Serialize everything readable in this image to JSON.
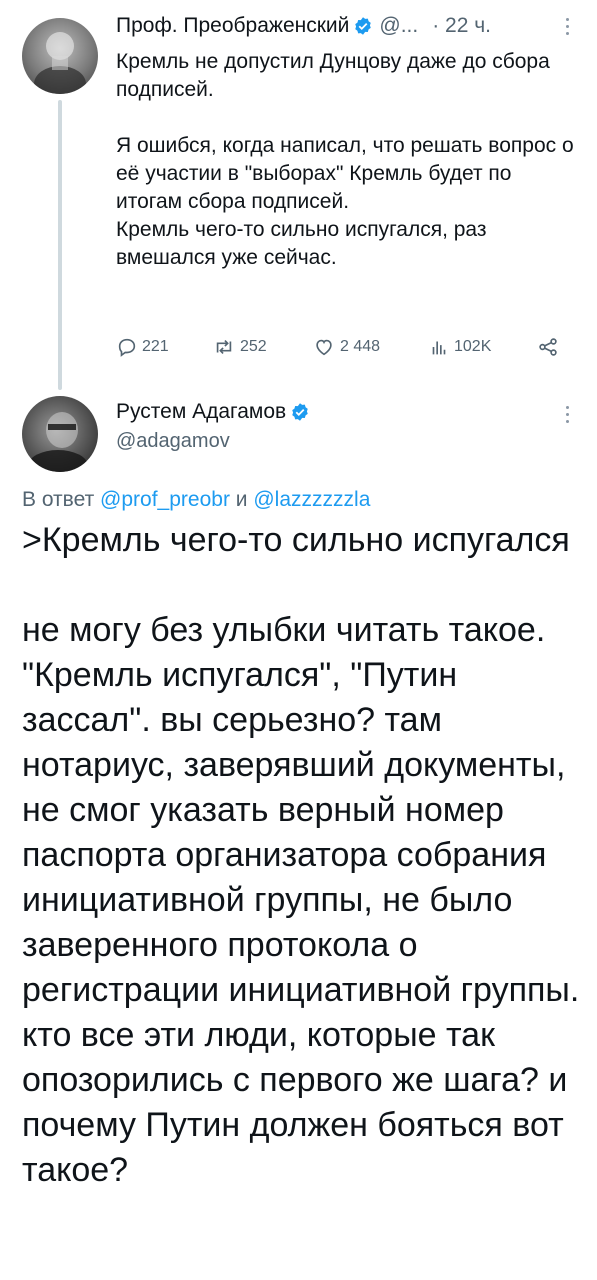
{
  "tweet1": {
    "author_name": "Проф. Преображенский",
    "handle": "@...",
    "time": "· 22 ч.",
    "body": "Кремль не допустил Дунцову даже до сбора подписей.\n\nЯ ошибся, когда написал, что решать вопрос о её участии в \"выборах\" Кремль будет по итогам сбора подписей.\nКремль чего-то сильно испугался, раз вмешался уже сейчас.",
    "actions": {
      "replies": "221",
      "retweets": "252",
      "likes": "2 448",
      "views": "102K"
    }
  },
  "tweet2": {
    "author_name": "Рустем Адагамов",
    "handle": "@adagamov",
    "reply_prefix": "В ответ",
    "reply_mention1": "@prof_preobr",
    "reply_and": "и",
    "reply_mention2": "@lazzzzzzla",
    "body": ">Кремль чего-то сильно испугался\n\nне могу без улыбки читать такое. \"Кремль испугался\", \"Путин зассал\". вы серьезно? там нотариус, заверявший документы, не смог указать верный номер паспорта организатора собрания инициативной группы, не было заверенного протокола о регистрации инициативной группы. кто все эти люди, которые так опозорились с первого же шага? и почему Путин должен бояться вот такое?"
  },
  "colors": {
    "verified": "#1d9bf0",
    "secondary_text": "#536471",
    "link": "#1d9bf0",
    "thread_line": "#cfd9de"
  },
  "icons": {
    "verified": "verified-badge-icon",
    "reply": "reply-icon",
    "retweet": "retweet-icon",
    "like": "heart-icon",
    "views": "views-bar-chart-icon",
    "share": "share-icon",
    "more": "more-vertical-icon"
  }
}
